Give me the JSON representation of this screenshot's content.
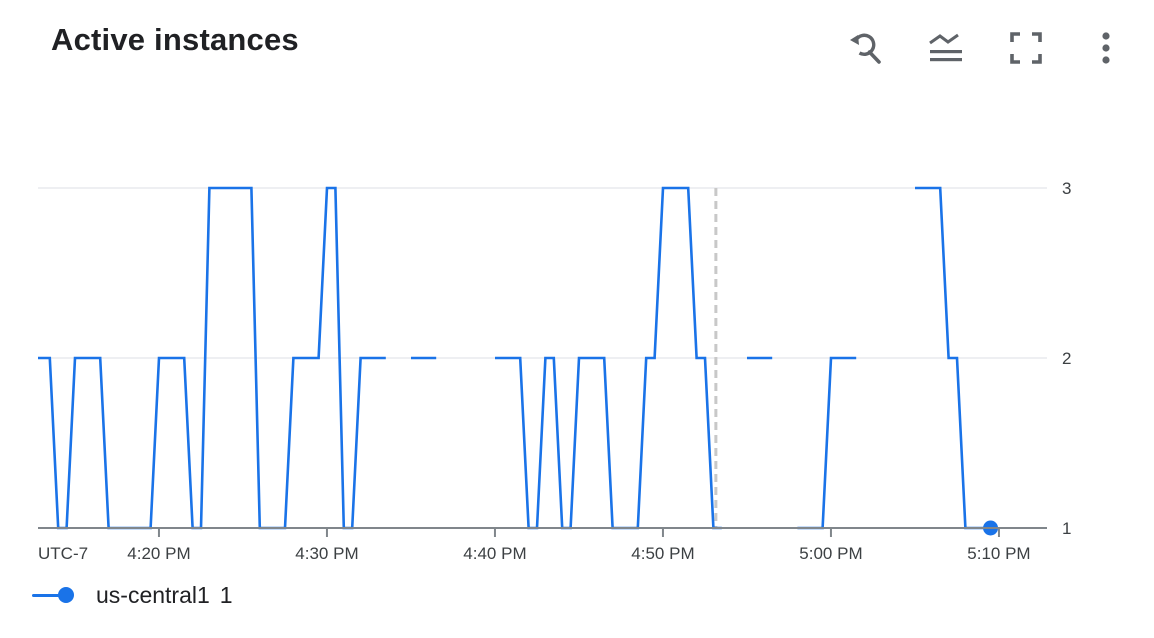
{
  "header": {
    "title": "Active instances",
    "toolbar": [
      {
        "name": "reset-zoom-button",
        "icon": "zoom-reset-icon",
        "tooltip": "Reset zoom"
      },
      {
        "name": "chart-style-button",
        "icon": "line-chart-style-icon",
        "tooltip": "Chart style"
      },
      {
        "name": "fullscreen-button",
        "icon": "fullscreen-icon",
        "tooltip": "Full screen"
      },
      {
        "name": "more-options-button",
        "icon": "more-vert-icon",
        "tooltip": "More options"
      }
    ]
  },
  "colors": {
    "series": "#1a73e8",
    "grid": "#e8eaed",
    "axis": "#80868b",
    "marker_line": "#c8c8c8",
    "text": "#202124",
    "icon": "#5f6368"
  },
  "chart_data": {
    "type": "line",
    "title": "Active instances",
    "xlabel": "",
    "ylabel": "",
    "timezone_label": "UTC-7",
    "x_units": "minutes after 4:20 PM",
    "xlim": [
      -7.2,
      52.86
    ],
    "ylim": [
      1,
      3
    ],
    "x_ticks": [
      {
        "value": 0,
        "label": "4:20 PM"
      },
      {
        "value": 10,
        "label": "4:30 PM"
      },
      {
        "value": 20,
        "label": "4:40 PM"
      },
      {
        "value": 30,
        "label": "4:50 PM"
      },
      {
        "value": 40,
        "label": "5:00 PM"
      },
      {
        "value": 50,
        "label": "5:10 PM"
      }
    ],
    "y_ticks": [
      {
        "value": 1,
        "label": "1"
      },
      {
        "value": 2,
        "label": "2"
      },
      {
        "value": 3,
        "label": "3"
      }
    ],
    "grid": true,
    "vertical_marker": {
      "x": 33.15,
      "style": "dashed"
    },
    "legend_position": "bottom-left",
    "series": [
      {
        "name": "us-central1",
        "current_value": "1",
        "segments": [
          [
            [
              -7.2,
              2
            ],
            [
              -6.5,
              2
            ],
            [
              -6.0,
              1
            ],
            [
              -5.5,
              1
            ],
            [
              -5.0,
              2
            ],
            [
              -3.5,
              2
            ],
            [
              -3.0,
              1
            ],
            [
              -0.5,
              1
            ],
            [
              0,
              2
            ],
            [
              1.5,
              2
            ],
            [
              2.0,
              1
            ],
            [
              2.5,
              1
            ],
            [
              3.0,
              3
            ],
            [
              5.5,
              3
            ],
            [
              6.0,
              1
            ],
            [
              7.5,
              1
            ],
            [
              8.0,
              2
            ],
            [
              9.5,
              2
            ],
            [
              10.0,
              3
            ],
            [
              10.5,
              3
            ],
            [
              11.0,
              1
            ],
            [
              11.5,
              1
            ],
            [
              12.0,
              2
            ],
            [
              13.5,
              2
            ]
          ],
          [
            [
              15.0,
              2
            ],
            [
              16.5,
              2
            ]
          ],
          [
            [
              20.0,
              2
            ],
            [
              21.5,
              2
            ],
            [
              22.0,
              1
            ],
            [
              22.5,
              1
            ],
            [
              23.0,
              2
            ],
            [
              23.5,
              2
            ],
            [
              24.0,
              1
            ],
            [
              24.5,
              1
            ],
            [
              25.0,
              2
            ],
            [
              26.5,
              2
            ],
            [
              27.0,
              1
            ],
            [
              28.5,
              1
            ],
            [
              29.0,
              2
            ],
            [
              29.5,
              2
            ],
            [
              30.0,
              3
            ],
            [
              31.5,
              3
            ],
            [
              32.0,
              2
            ],
            [
              32.5,
              2
            ],
            [
              33.0,
              1
            ],
            [
              33.5,
              1
            ]
          ],
          [
            [
              35.0,
              2
            ],
            [
              36.5,
              2
            ]
          ],
          [
            [
              38.0,
              1
            ],
            [
              39.5,
              1
            ],
            [
              40.0,
              2
            ],
            [
              41.5,
              2
            ]
          ],
          [
            [
              45.0,
              3
            ],
            [
              46.5,
              3
            ],
            [
              47.0,
              2
            ],
            [
              47.5,
              2
            ],
            [
              48.0,
              1
            ],
            [
              49.0,
              1
            ],
            [
              49.5,
              1
            ]
          ]
        ],
        "last_point": [
          49.5,
          1
        ]
      }
    ]
  },
  "legend": {
    "items": [
      {
        "label": "us-central1",
        "value": "1"
      }
    ]
  }
}
